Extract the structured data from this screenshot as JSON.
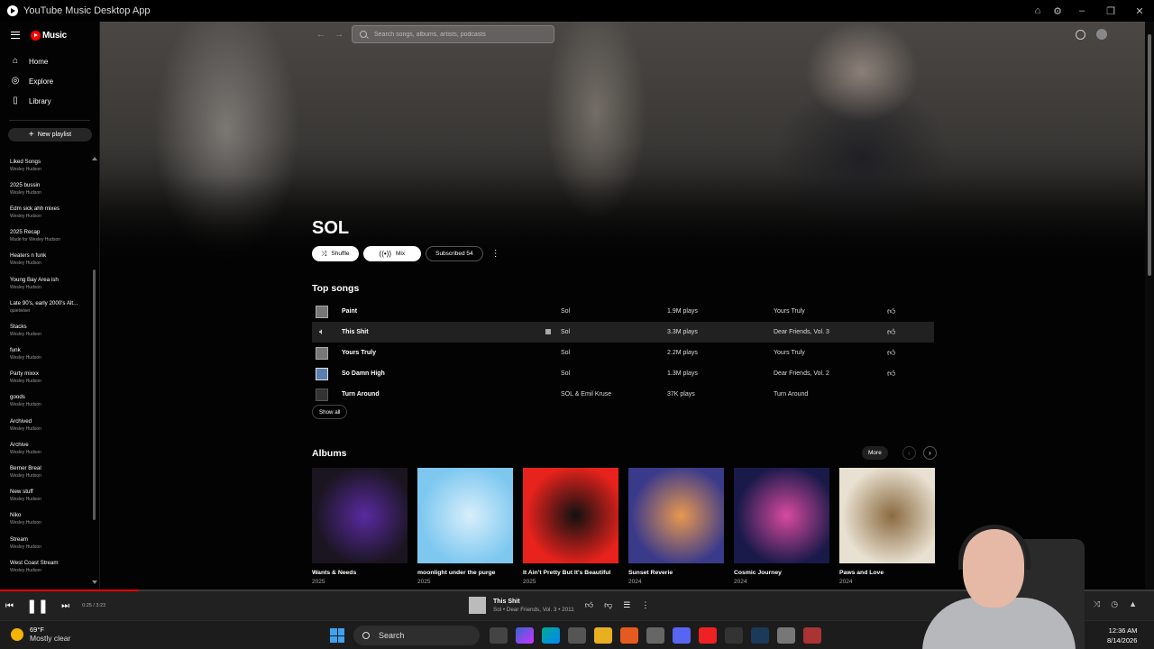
{
  "window": {
    "title": "YouTube Music Desktop App"
  },
  "sidebar": {
    "logo_text": "Music",
    "nav": [
      {
        "label": "Home",
        "icon": "home-icon"
      },
      {
        "label": "Explore",
        "icon": "compass-icon"
      },
      {
        "label": "Library",
        "icon": "library-icon"
      }
    ],
    "new_playlist": "New playlist",
    "playlists": [
      {
        "name": "Liked Songs",
        "owner": "Wesley Hudson"
      },
      {
        "name": "2025 bussin",
        "owner": "Wesley Hudson"
      },
      {
        "name": "Edm sick ahh mixes",
        "owner": "Wesley Hudson"
      },
      {
        "name": "2025 Recap",
        "owner": "Made for Wesley Hudson"
      },
      {
        "name": "Heaters n funk",
        "owner": "Wesley Hudson"
      },
      {
        "name": "Young Bay Area ish",
        "owner": "Wesley Hudson"
      },
      {
        "name": "Late 90's, early 2000's Alt...",
        "owner": "quietwiser"
      },
      {
        "name": "Stacks",
        "owner": "Wesley Hudson"
      },
      {
        "name": "funk",
        "owner": "Wesley Hudson"
      },
      {
        "name": "Party mixxx",
        "owner": "Wesley Hudson"
      },
      {
        "name": "goods",
        "owner": "Wesley Hudson"
      },
      {
        "name": "Archived",
        "owner": "Wesley Hudson"
      },
      {
        "name": "Archive",
        "owner": "Wesley Hudson"
      },
      {
        "name": "Berner Breal",
        "owner": "Wesley Hudson"
      },
      {
        "name": "New stuff",
        "owner": "Wesley Hudson"
      },
      {
        "name": "Niko",
        "owner": "Wesley Hudson"
      },
      {
        "name": "Stream",
        "owner": "Wesley Hudson"
      },
      {
        "name": "West Coast Stream",
        "owner": "Wesley Hudson"
      }
    ]
  },
  "search": {
    "placeholder": "Search songs, albums, artists, podcasts"
  },
  "artist": {
    "name": "SOL",
    "shuffle_label": "Shuffle",
    "mix_label": "Mix",
    "subscribed_label": "Subscribed 54"
  },
  "top_songs": {
    "title": "Top songs",
    "show_all": "Show all",
    "rows": [
      {
        "title": "Paint",
        "artist": "Sol",
        "plays": "1.9M plays",
        "album": "Yours Truly",
        "thumb": "grey"
      },
      {
        "title": "This Shit",
        "artist": "Sol",
        "plays": "3.3M plays",
        "album": "Dear Friends, Vol. 3",
        "thumb": "speaker",
        "active": true
      },
      {
        "title": "Yours Truly",
        "artist": "Sol",
        "plays": "2.2M plays",
        "album": "Yours Truly",
        "thumb": "grey"
      },
      {
        "title": "So Damn High",
        "artist": "Sol",
        "plays": "1.3M plays",
        "album": "Dear Friends, Vol. 2",
        "thumb": "blue"
      },
      {
        "title": "Turn Around",
        "artist": "SOL & Emil Kruse",
        "plays": "37K plays",
        "album": "Turn Around",
        "thumb": "dark"
      }
    ]
  },
  "albums": {
    "title": "Albums",
    "more_label": "More",
    "items": [
      {
        "title": "Wants & Needs",
        "year": "2025",
        "colors": [
          "#1a1520",
          "#5a2aa0"
        ]
      },
      {
        "title": "moonlight under the purge",
        "year": "2025",
        "colors": [
          "#7ec8f0",
          "#d8eefb"
        ]
      },
      {
        "title": "It Ain't Pretty But It's Beautiful",
        "year": "2025",
        "colors": [
          "#e8221c",
          "#111111"
        ]
      },
      {
        "title": "Sunset Reverie",
        "year": "2024",
        "colors": [
          "#3a3a8a",
          "#e89850"
        ]
      },
      {
        "title": "Cosmic Journey",
        "year": "2024",
        "colors": [
          "#1a1a4a",
          "#d84aa0"
        ]
      },
      {
        "title": "Paws and Love",
        "year": "2024",
        "colors": [
          "#e8e0d0",
          "#8a6a40"
        ]
      }
    ]
  },
  "player": {
    "time": "0:25 / 3:23",
    "progress": 0.12,
    "now_title": "This Shit",
    "now_sub": "Sol • Dear Friends, Vol. 3 • 2011"
  },
  "taskbar": {
    "temp": "69°F",
    "weather": "Mostly clear",
    "search_label": "Search",
    "time": "12:36 AM",
    "date": "8/14/2026"
  }
}
